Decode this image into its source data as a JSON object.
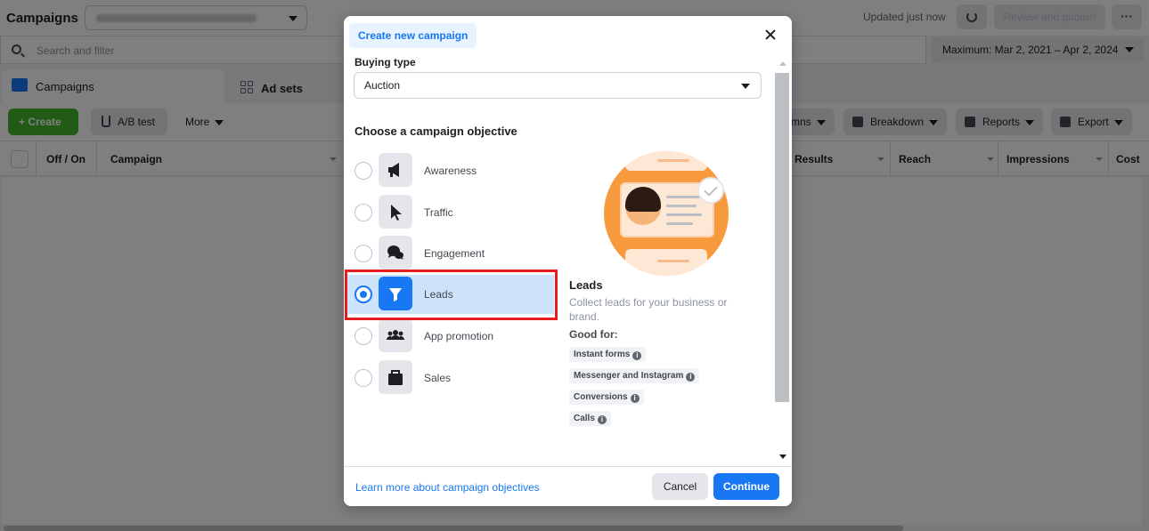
{
  "app": {
    "title": "Campaigns",
    "updated_text": "Updated just now",
    "review_publish_label": "Review and publish",
    "more_dots": "···"
  },
  "search": {
    "placeholder": "Search and filter"
  },
  "date_range": {
    "label": "Maximum: Mar 2, 2021 – Apr 2, 2024"
  },
  "tabs": [
    {
      "label": "Campaigns",
      "icon": "folder-icon"
    },
    {
      "label": "Ad sets",
      "icon": "grid-icon"
    }
  ],
  "toolbar": {
    "create_label": "+ Create",
    "ab_test_label": "A/B test",
    "more_label": "More",
    "columns_label": "mns",
    "breakdown_label": "Breakdown",
    "reports_label": "Reports",
    "export_label": "Export"
  },
  "table": {
    "headers": [
      "Off / On",
      "Campaign",
      "Results",
      "Reach",
      "Impressions",
      "Cost"
    ]
  },
  "modal": {
    "tab_label": "Create new campaign",
    "buying_type_label": "Buying type",
    "buying_type_value": "Auction",
    "objective_title": "Choose a campaign objective",
    "objectives": [
      {
        "label": "Awareness",
        "icon": "megaphone-icon",
        "selected": false
      },
      {
        "label": "Traffic",
        "icon": "cursor-icon",
        "selected": false
      },
      {
        "label": "Engagement",
        "icon": "chat-bubbles-icon",
        "selected": false
      },
      {
        "label": "Leads",
        "icon": "funnel-icon",
        "selected": true
      },
      {
        "label": "App promotion",
        "icon": "people-icon",
        "selected": false
      },
      {
        "label": "Sales",
        "icon": "shopping-bag-icon",
        "selected": false
      }
    ],
    "detail": {
      "title": "Leads",
      "description": "Collect leads for your business or brand.",
      "good_for_label": "Good for:",
      "chips": [
        "Instant forms",
        "Messenger and Instagram",
        "Conversions",
        "Calls"
      ]
    },
    "footer": {
      "learn_more": "Learn more about campaign objectives",
      "cancel_label": "Cancel",
      "continue_label": "Continue"
    }
  },
  "colors": {
    "accent": "#1877f2",
    "create_green": "#42b72a",
    "selected_bg": "#cde3fc",
    "highlight_red": "#e41e1e",
    "illustration_orange": "#f79a3e"
  }
}
